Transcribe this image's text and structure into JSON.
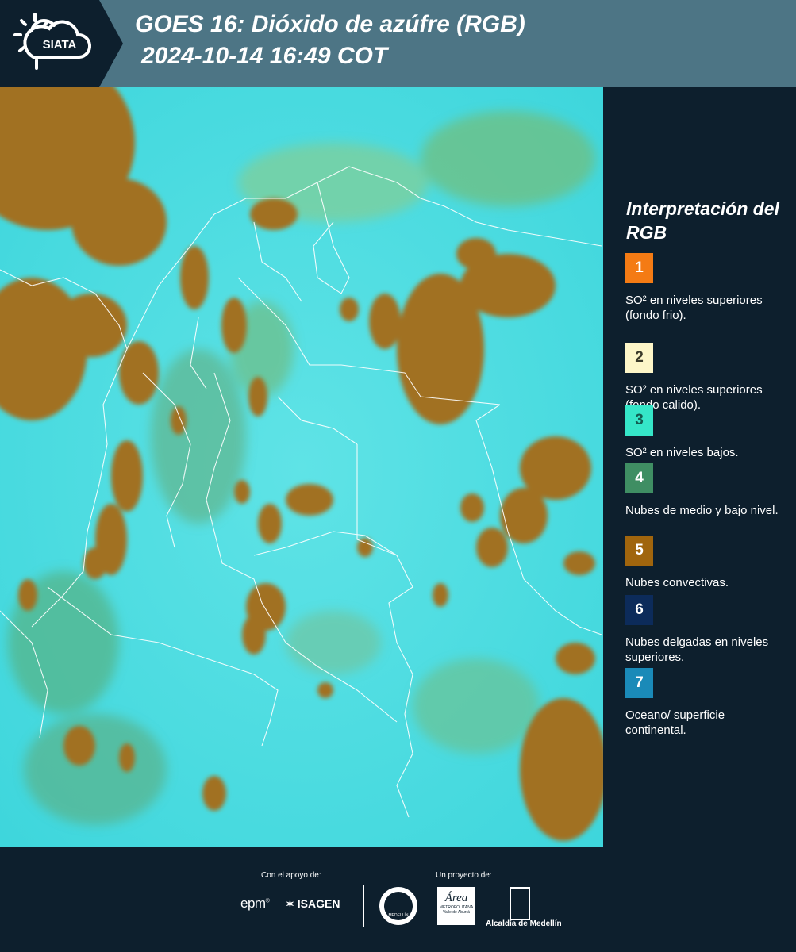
{
  "header": {
    "title_line1": "GOES 16: Dióxido de azúfre (RGB)",
    "title_line2": "2024-10-14 16:49 COT",
    "logo_text": "SIATA"
  },
  "legend": {
    "title": "Interpretación del RGB",
    "items": [
      {
        "number": "1",
        "color": "#f47b14",
        "number_color": "#ffffff",
        "text": "SO² en niveles superiores (fondo frio)."
      },
      {
        "number": "2",
        "color": "#fdf6c8",
        "number_color": "#3a3a2a",
        "text": "SO² en niveles superiores (fondo calido)."
      },
      {
        "number": "3",
        "color": "#35e6c8",
        "number_color": "#135c50",
        "text": "SO² en niveles bajos."
      },
      {
        "number": "4",
        "color": "#3f8e63",
        "number_color": "#ffffff",
        "text": "Nubes de medio y bajo nivel."
      },
      {
        "number": "5",
        "color": "#a0650d",
        "number_color": "#ffffff",
        "text": "Nubes convectivas."
      },
      {
        "number": "6",
        "color": "#0c2b5a",
        "number_color": "#ffffff",
        "text": "Nubes delgadas en niveles superiores."
      },
      {
        "number": "7",
        "color": "#1a8ab8",
        "number_color": "#ffffff",
        "text": "Oceano/ superficie continental."
      }
    ]
  },
  "footer": {
    "support_label": "Con el apoyo de:",
    "project_label": "Un proyecto de:",
    "epm": "epm",
    "isagen": "ISAGEN",
    "area_label": "Área",
    "area_sub": "METROPOLITANA",
    "area_sub2": "Valle de Aburrá",
    "alcaldia": "Alcaldía de Medellín",
    "medellin_seal": "MEDELLÍN"
  }
}
